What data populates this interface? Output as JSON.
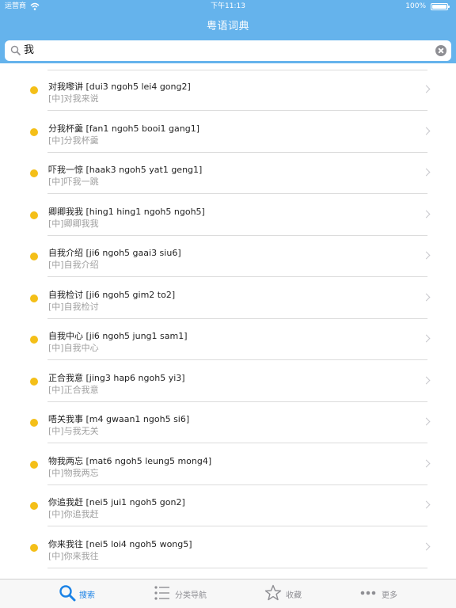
{
  "status_bar": {
    "carrier": "运营商",
    "time": "下午11:13",
    "battery": "100%"
  },
  "nav": {
    "title": "粤语词典"
  },
  "search": {
    "query": "我"
  },
  "results": [
    {
      "title": "对我嚟讲 [dui3 ngoh5 lei4 gong2]",
      "subtitle": "[中]对我来说"
    },
    {
      "title": "分我杯羹 [fan1 ngoh5 booi1 gang1]",
      "subtitle": "[中]分我杯羹"
    },
    {
      "title": "吓我一惊 [haak3 ngoh5 yat1 geng1]",
      "subtitle": "[中]吓我一跳"
    },
    {
      "title": "卿卿我我 [hing1 hing1 ngoh5 ngoh5]",
      "subtitle": "[中]卿卿我我"
    },
    {
      "title": "自我介绍 [ji6 ngoh5 gaai3 siu6]",
      "subtitle": "[中]自我介绍"
    },
    {
      "title": "自我检讨 [ji6 ngoh5 gim2 to2]",
      "subtitle": "[中]自我检讨"
    },
    {
      "title": "自我中心 [ji6 ngoh5 jung1 sam1]",
      "subtitle": "[中]自我中心"
    },
    {
      "title": "正合我意 [jing3 hap6 ngoh5 yi3]",
      "subtitle": "[中]正合我意"
    },
    {
      "title": "唔关我事 [m4 gwaan1 ngoh5 si6]",
      "subtitle": "[中]与我无关"
    },
    {
      "title": "物我两忘 [mat6 ngoh5 leung5 mong4]",
      "subtitle": "[中]物我两忘"
    },
    {
      "title": "你追我赶 [nei5 jui1 ngoh5 gon2]",
      "subtitle": "[中]你追我赶"
    },
    {
      "title": "你来我往 [nei5 loi4 ngoh5 wong5]",
      "subtitle": "[中]你来我往"
    }
  ],
  "tabs": [
    {
      "label": "搜索",
      "icon": "search-icon",
      "active": true
    },
    {
      "label": "分类导航",
      "icon": "list-icon",
      "active": false
    },
    {
      "label": "收藏",
      "icon": "star-icon",
      "active": false
    },
    {
      "label": "更多",
      "icon": "more-icon",
      "active": false
    }
  ],
  "colors": {
    "header": "#65b3ec",
    "dot": "#f4bf18",
    "tab_active": "#1a82e6",
    "tab_inactive": "#8e8e93"
  }
}
